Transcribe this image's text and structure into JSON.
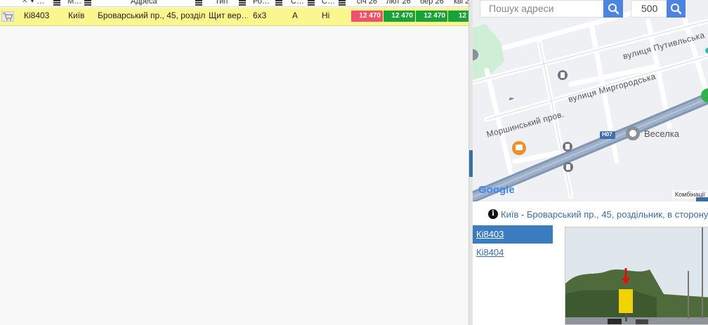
{
  "grid": {
    "headers": [
      {
        "key": "cart",
        "label": ""
      },
      {
        "key": "code",
        "label": "…"
      },
      {
        "key": "city",
        "label": "М…"
      },
      {
        "key": "address",
        "label": "Адреса"
      },
      {
        "key": "type",
        "label": "Тип"
      },
      {
        "key": "size",
        "label": "Ро…"
      },
      {
        "key": "side",
        "label": "С…"
      },
      {
        "key": "light",
        "label": "С…"
      },
      {
        "key": "m1",
        "label": "січ 26"
      },
      {
        "key": "m2",
        "label": "лют 26"
      },
      {
        "key": "m3",
        "label": "бер 26"
      },
      {
        "key": "m4",
        "label": "кві 2"
      }
    ],
    "row": {
      "code": "Кі8403",
      "city": "Київ",
      "address": "Броварський пр., 45, розділ…",
      "type": "Щит вер…",
      "size": "6x3",
      "side": "А",
      "light": "Ні",
      "prices": [
        {
          "value": "12 470",
          "color": "#f0506a"
        },
        {
          "value": "12 470",
          "color": "#17a337"
        },
        {
          "value": "12 470",
          "color": "#17a337"
        },
        {
          "value": "12",
          "color": "#17a337"
        }
      ]
    }
  },
  "map": {
    "search_placeholder": "Пошук адреси",
    "radius_value": "500",
    "labels": {
      "street1": "вулиця Путивльська",
      "street2": "вулиця Миргородська",
      "street3": "Моршинський пров.",
      "poi": "Веселка",
      "route": "H07",
      "google": "Google",
      "combo": "Комбінації"
    }
  },
  "info": {
    "title": "Київ - Броварський пр., 45, роздільник, в сторону",
    "items": [
      {
        "code": "Кі8403",
        "selected": true
      },
      {
        "code": "Кі8404",
        "selected": false
      }
    ]
  }
}
